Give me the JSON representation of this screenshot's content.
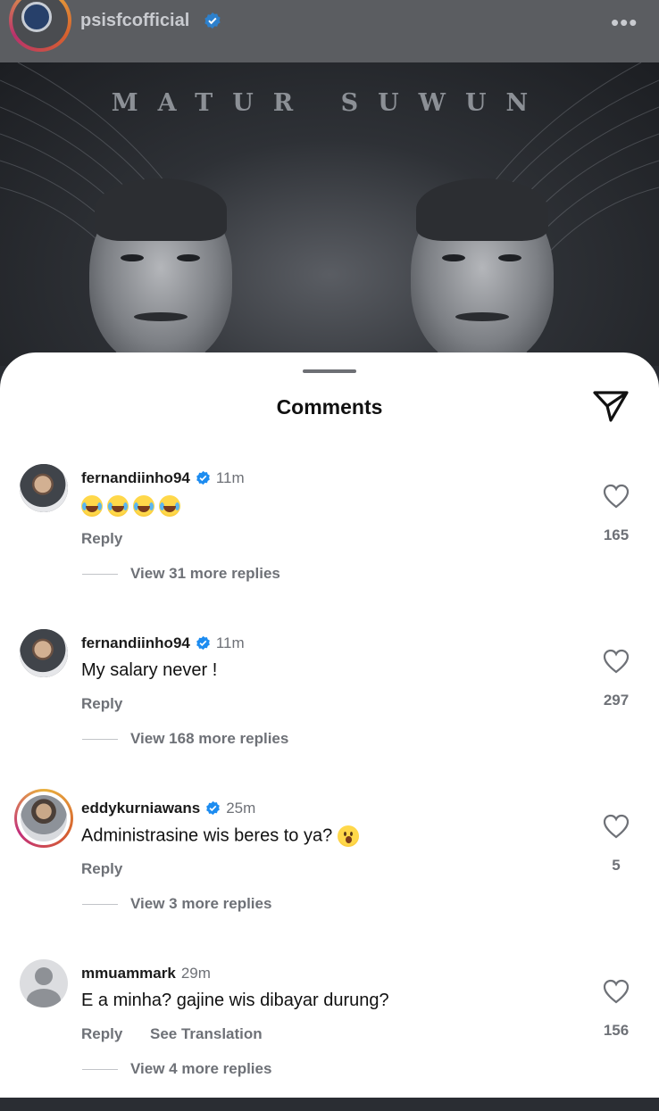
{
  "header": {
    "username": "psisfcofficial",
    "more_icon": "more-horizontal-icon"
  },
  "post_image": {
    "title": "MATUR SUWUN"
  },
  "sheet": {
    "title": "Comments",
    "share_icon": "paper-plane-icon"
  },
  "comments": [
    {
      "username": "fernandiinho94",
      "verified": true,
      "time": "11m",
      "text": "",
      "emoji": [
        "laughing-crying-face",
        "laughing-crying-face",
        "laughing-crying-face",
        "laughing-crying-face"
      ],
      "reply_label": "Reply",
      "likes": "165",
      "view_more": "View 31 more replies"
    },
    {
      "username": "fernandiinho94",
      "verified": true,
      "time": "11m",
      "text": "My salary never !",
      "reply_label": "Reply",
      "likes": "297",
      "view_more": "View 168 more replies"
    },
    {
      "username": "eddykurniawans",
      "verified": true,
      "time": "25m",
      "text": "Administrasine wis beres to ya?",
      "emoji": [
        "astonished-face"
      ],
      "reply_label": "Reply",
      "likes": "5",
      "view_more": "View 3 more replies"
    },
    {
      "username": "mmuammark",
      "verified": false,
      "time": "29m",
      "text": "E a minha? gajine wis dibayar durung?",
      "reply_label": "Reply",
      "translation_label": "See Translation",
      "likes": "156",
      "view_more": "View 4 more replies"
    }
  ],
  "colors": {
    "verified_blue": "#1d8cf0",
    "muted_text": "#6e7177",
    "sheet_background": "#ffffff"
  }
}
